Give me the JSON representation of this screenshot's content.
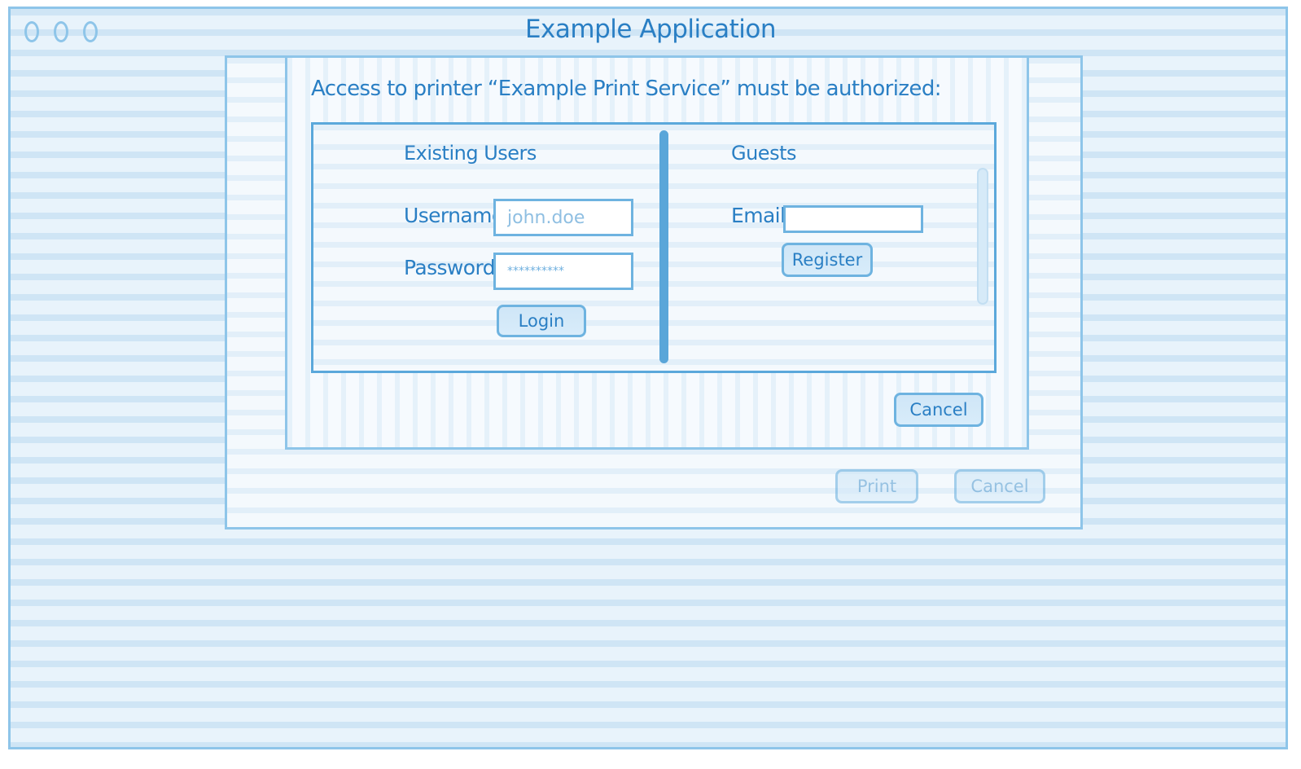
{
  "window": {
    "title": "Example Application",
    "controls": [
      "close-icon",
      "minimize-icon",
      "zoom-icon"
    ]
  },
  "auth_dialog": {
    "message": "Access to printer “Example Print Service” must be authorized:",
    "existing_users": {
      "title": "Existing Users",
      "username_label": "Username:",
      "username_placeholder": "john.doe",
      "password_label": "Password:",
      "password_value": "**********",
      "login_label": "Login"
    },
    "guests": {
      "title": "Guests",
      "email_label": "Email:",
      "email_value": "",
      "register_label": "Register"
    },
    "cancel_label": "Cancel"
  },
  "print_sheet": {
    "print_label": "Print",
    "cancel_label": "Cancel"
  },
  "colors": {
    "accent": "#2a7fc4",
    "border": "#8ec5e9",
    "background": "#e6f2fb"
  }
}
